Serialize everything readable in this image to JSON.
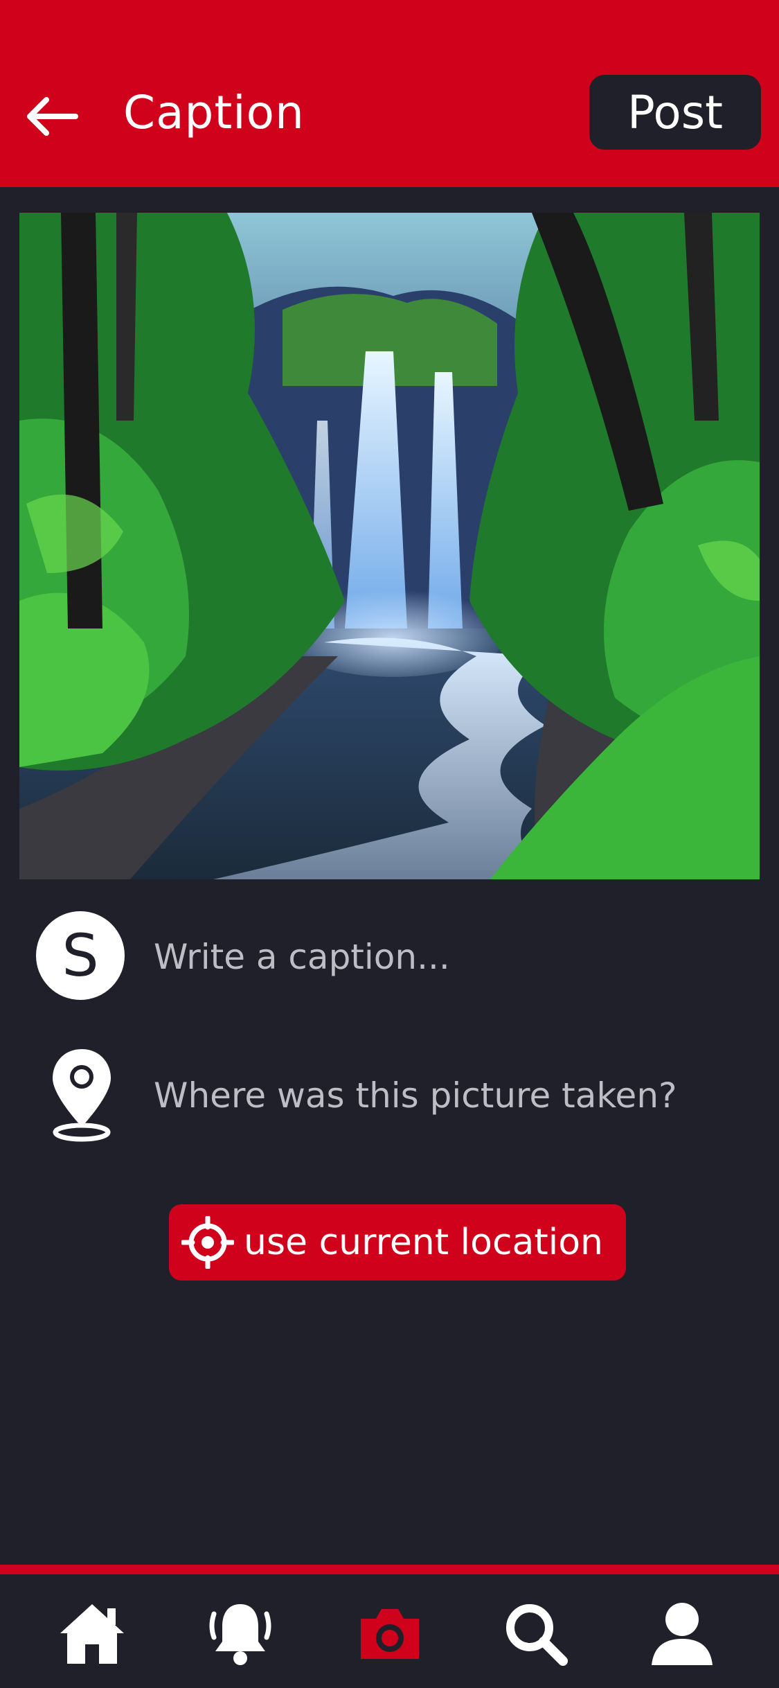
{
  "header": {
    "title": "Caption",
    "post_label": "Post"
  },
  "photo": {
    "subject": "waterfall-forest-painting"
  },
  "caption": {
    "avatar_letter": "S",
    "placeholder": "Write a caption..."
  },
  "location": {
    "placeholder": "Where was this picture taken?",
    "use_current_label": "use current location"
  },
  "nav": {
    "items": [
      {
        "name": "home",
        "icon": "home-icon",
        "active": false
      },
      {
        "name": "notifications",
        "icon": "bell-icon",
        "active": false
      },
      {
        "name": "camera",
        "icon": "camera-icon",
        "active": true
      },
      {
        "name": "search",
        "icon": "search-icon",
        "active": false
      },
      {
        "name": "profile",
        "icon": "user-icon",
        "active": false
      }
    ]
  },
  "colors": {
    "accent": "#d0021b",
    "background": "#20202b",
    "text": "#ffffff"
  }
}
